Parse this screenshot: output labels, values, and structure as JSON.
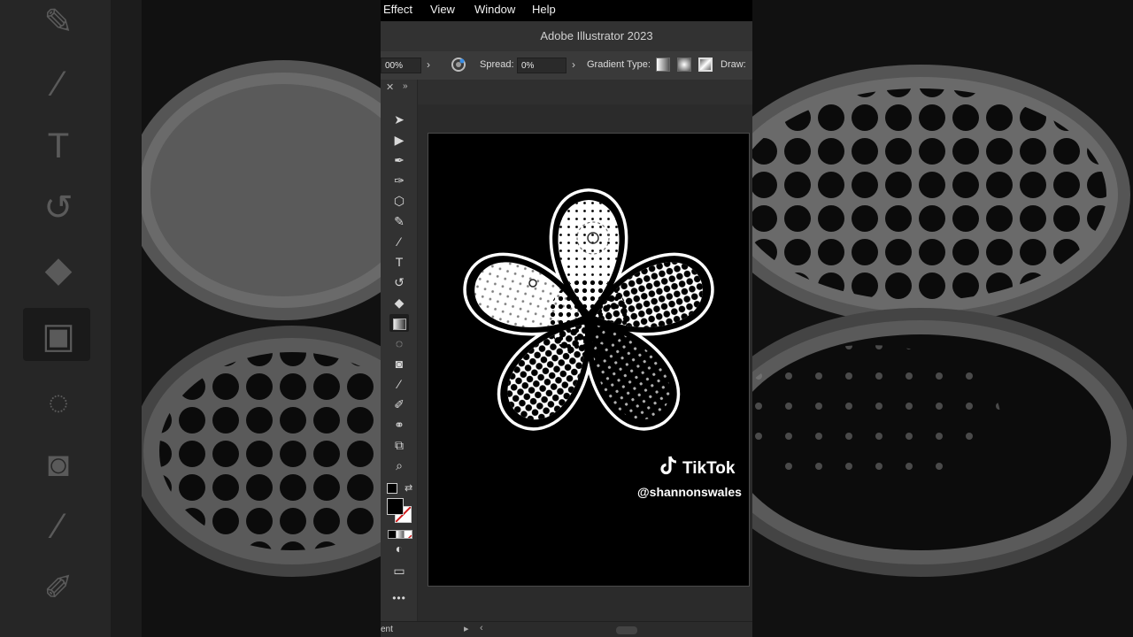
{
  "menu": {
    "effect": "Effect",
    "view": "View",
    "window": "Window",
    "help": "Help"
  },
  "window": {
    "title": "Adobe Illustrator 2023"
  },
  "control_bar": {
    "opacity_value": "00%",
    "spread_label": "Spread:",
    "spread_value": "0%",
    "gradient_type_label": "Gradient Type:",
    "draw_label": "Draw:"
  },
  "toolbar": {
    "tools": [
      "selection-tool",
      "direct-selection-tool",
      "pen-tool",
      "curvature-tool",
      "shape-tool",
      "shaper-tool",
      "paintbrush-tool",
      "type-tool",
      "rotate-tool",
      "eraser-tool",
      "gradient-tool",
      "shape-builder-tool",
      "live-paint-tool",
      "eyedropper-tool",
      "pencil-tool",
      "blend-tool",
      "artboard-tool",
      "zoom-tool"
    ],
    "active_tool": "gradient-tool",
    "more_label": "•••"
  },
  "status_bar": {
    "text": "ent"
  },
  "watermark": {
    "brand": "TikTok",
    "handle": "@shannonswales"
  },
  "colors": {
    "menubar_bg": "#000000",
    "canvas_bg": "#000000",
    "panel_bg": "#323232",
    "flower_outline": "#ffffff"
  }
}
